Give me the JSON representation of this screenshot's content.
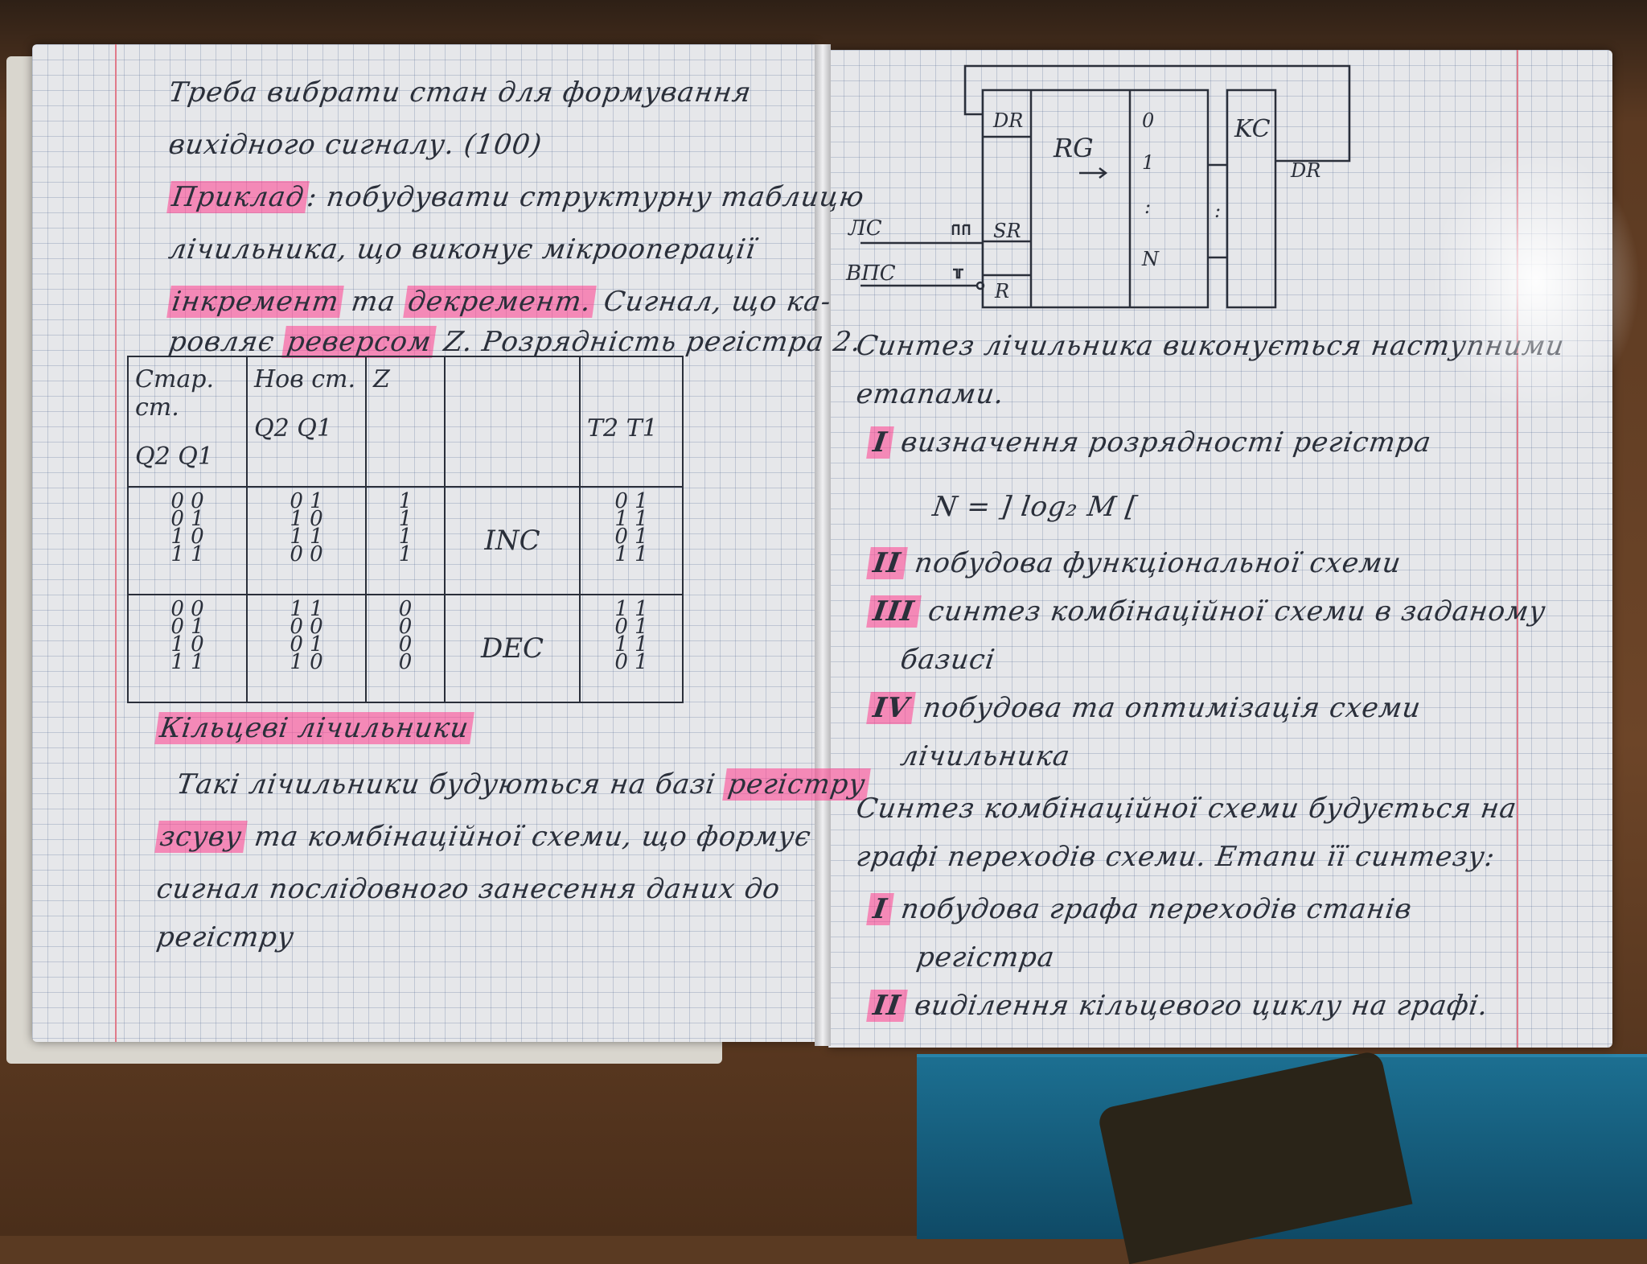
{
  "left_page": {
    "line1": "Треба вибрати стан для формування",
    "line2": "вихідного сигналу. (100)",
    "example_label": "Приклад",
    "line3_rest": ": побудувати структурну таблицю",
    "line4": "лічильника, що виконує мікрооперації",
    "increment": "інкремент",
    "ta": "та",
    "decrement": "декремент.",
    "line5_rest": "Сигнал, що ка-",
    "line6_a": "ровляє",
    "reverse": "реверсом",
    "line6_b": "Z. Розрядність регістра 2.",
    "table": {
      "h_old_1": "Стар. ст.",
      "h_old_2": "Q2 Q1",
      "h_new_1": "Нов ст.",
      "h_new_2": "Q2 Q1",
      "h_z": "Z",
      "h_op": "",
      "h_t": "T2 T1",
      "groups": [
        {
          "op": "INC",
          "old": [
            "0 0",
            "0 1",
            "1 0",
            "1 1"
          ],
          "new": [
            "0 1",
            "1 0",
            "1 1",
            "0 0"
          ],
          "z": [
            "1",
            "1",
            "1",
            "1"
          ],
          "t": [
            "0 1",
            "1 1",
            "0 1",
            "1 1"
          ]
        },
        {
          "op": "DEC",
          "old": [
            "0 0",
            "0 1",
            "1 0",
            "1 1"
          ],
          "new": [
            "1 1",
            "0 0",
            "0 1",
            "1 0"
          ],
          "z": [
            "0",
            "0",
            "0",
            "0"
          ],
          "t": [
            "1 1",
            "0 1",
            "1 1",
            "0 1"
          ]
        }
      ]
    },
    "ring_title": "Кільцеві лічильники",
    "ring_line1_a": "Такі лічильники будуються на базі",
    "ring_register": "регістру",
    "ring_shift": "зсуву",
    "ring_line2_rest": "та комбінаційної схеми, що формує",
    "ring_line3": "сигнал послідовного занесення даних до",
    "ring_line4": "регістру"
  },
  "right_page": {
    "diagram": {
      "dr_in": "DR",
      "rg": "RG",
      "q0": "0",
      "q1": "1",
      "qdots": ":",
      "qn": "N",
      "sr": "SR",
      "r": "R",
      "kc": "KC",
      "dr_out": "DR",
      "mid_dots": ":",
      "signal_lc": "ЛС",
      "signal_vps": "ВПС"
    },
    "line1": "Синтез лічильника виконується наступними",
    "line2": "етапами.",
    "steps": [
      {
        "num": "I",
        "text": "визначення розрядності регістра"
      },
      {
        "num": "II",
        "text": "побудова функціональної схеми"
      },
      {
        "num": "III",
        "text": "синтез комбінаційної схеми в заданому"
      },
      {
        "num": "IV",
        "text": "побудова та оптимізація схеми"
      }
    ],
    "formula": "N = ] log₂ M [",
    "step3_cont": "базисі",
    "step4_cont": "лічильника",
    "synth_line1": "Синтез комбінаційної схеми будується на",
    "synth_line2": "графі переходів схеми. Етапи її синтезу:",
    "sub_steps": [
      {
        "num": "I",
        "text": "побудова графа переходів станів"
      },
      {
        "num": "II",
        "text": "виділення кільцевого циклу на графі."
      }
    ],
    "sub1_cont": "регістра"
  }
}
